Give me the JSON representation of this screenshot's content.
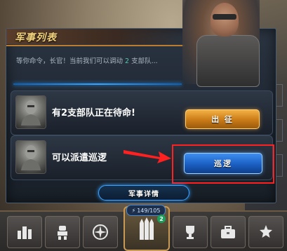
{
  "panel": {
    "title": "军事列表",
    "message_prefix": "等你命令，长官！当前我们可以调动",
    "available_count": "2",
    "message_suffix": "支部队..."
  },
  "rows": [
    {
      "text": "有2支部队正在待命!",
      "button_label": "出 征"
    },
    {
      "text": "可以派遣巡逻",
      "button_label": "巡逻"
    }
  ],
  "details_button": "军事详情",
  "bottom_bar": {
    "energy": "149/105",
    "badge": "2",
    "icons": [
      "buildings-icon",
      "robot-icon",
      "compass-icon",
      "missiles-icon",
      "trophy-icon",
      "toolbox-icon",
      "medal-icon"
    ]
  },
  "colors": {
    "accent_orange": "#c97a16",
    "accent_blue": "#1b5fc2",
    "highlight_red": "#ff2020"
  }
}
